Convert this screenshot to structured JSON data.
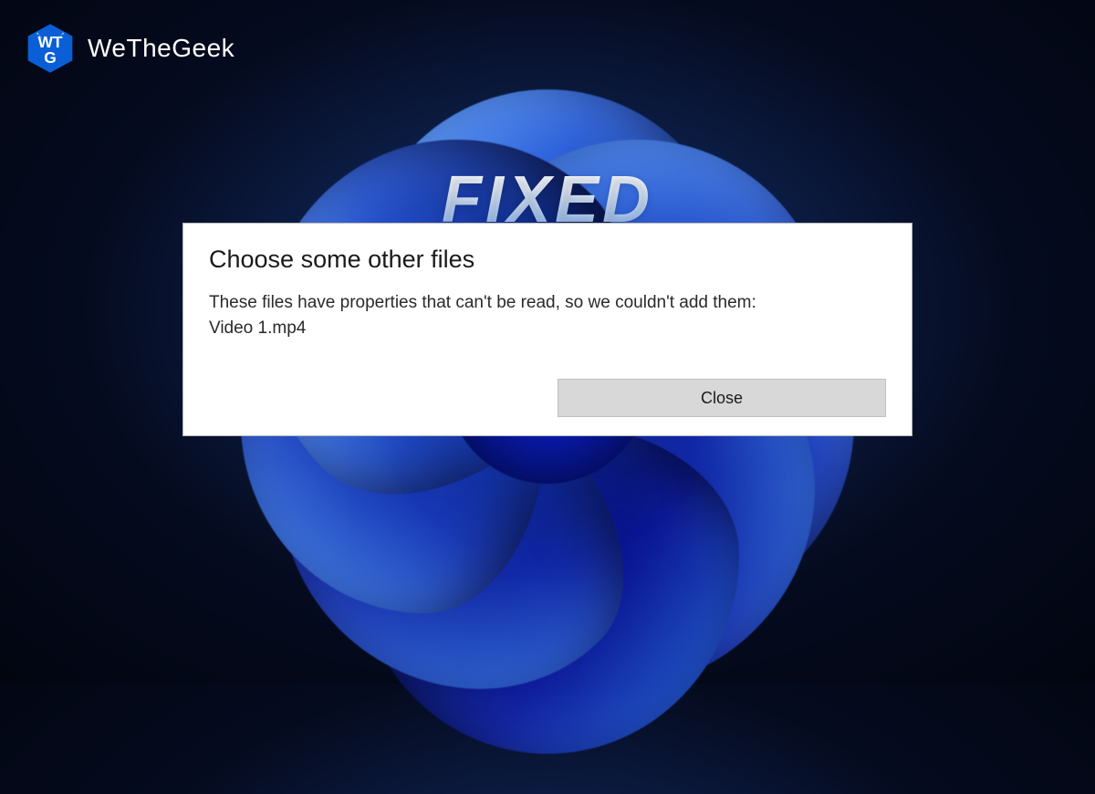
{
  "brand": {
    "name": "WeTheGeek",
    "logo_letters": "WTG"
  },
  "overlay": {
    "headline": "FIXED"
  },
  "dialog": {
    "title": "Choose some other files",
    "message": "These files have properties that can't be read, so we couldn't add them:\nVideo 1.mp4",
    "close_label": "Close"
  }
}
